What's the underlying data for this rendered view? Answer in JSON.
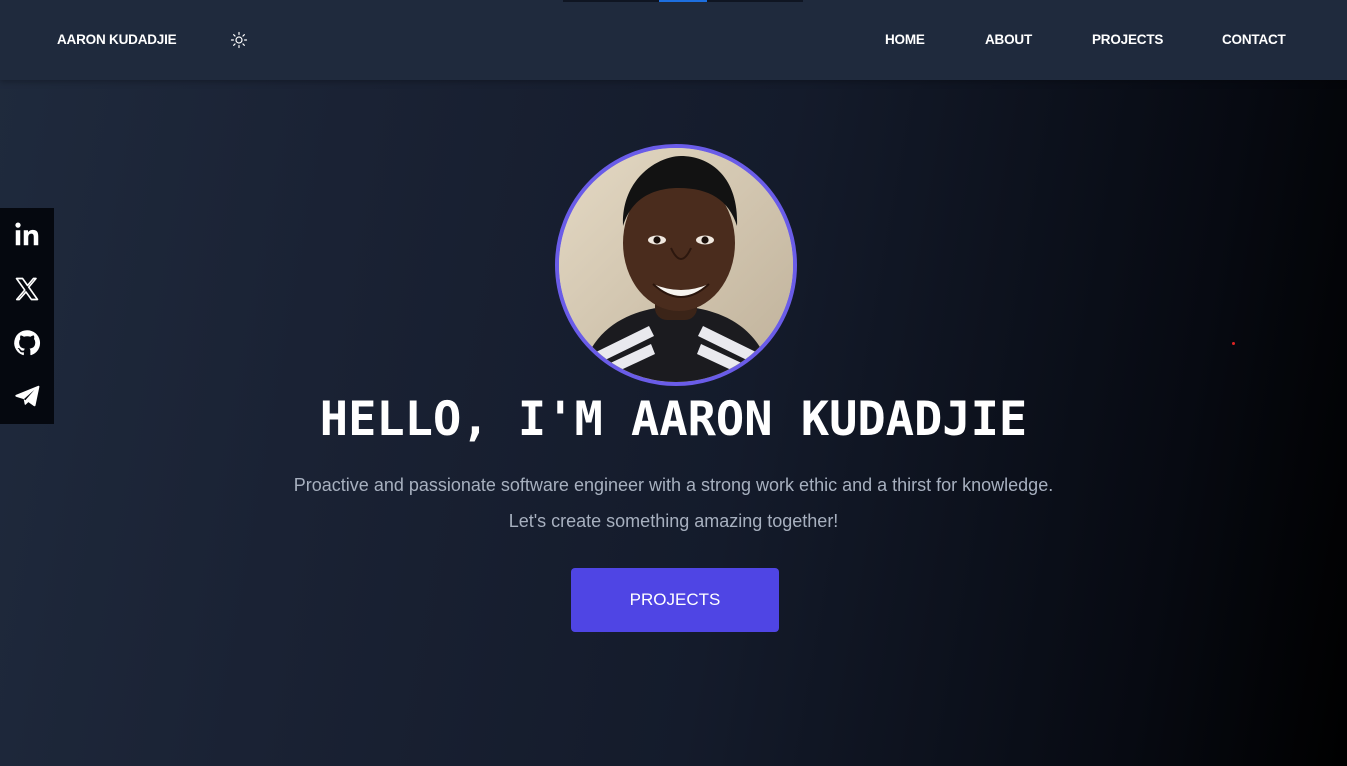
{
  "header": {
    "brand": "AARON KUDADJIE",
    "theme_icon": "sun-icon",
    "nav": [
      {
        "label": "HOME"
      },
      {
        "label": "ABOUT"
      },
      {
        "label": "PROJECTS"
      },
      {
        "label": "CONTACT"
      }
    ]
  },
  "social": [
    {
      "icon": "linkedin-icon"
    },
    {
      "icon": "x-twitter-icon"
    },
    {
      "icon": "github-icon"
    },
    {
      "icon": "telegram-icon"
    }
  ],
  "hero": {
    "avatar_icon": "profile-photo",
    "headline": "HELLO, I'M AARON KUDADJIE",
    "tagline_1": "Proactive and passionate software engineer with a strong work ethic and a thirst for knowledge.",
    "tagline_2": "Let's create something amazing together!",
    "cta_label": "PROJECTS"
  },
  "colors": {
    "navbar": "#1f2a3d",
    "accent": "#4f45e4",
    "avatar_ring": "#6a5ce8",
    "text_muted": "#a7b0bf"
  }
}
